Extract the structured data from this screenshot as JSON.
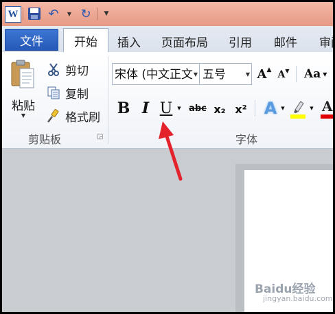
{
  "quick_access": {
    "app_icon": "word-icon",
    "app_letter": "W",
    "save_icon": "save-icon",
    "undo_icon": "undo-icon",
    "redo_icon": "redo-icon",
    "customize_icon": "customize-icon"
  },
  "tabs": {
    "file": "文件",
    "home": "开始",
    "items": [
      "插入",
      "页面布局",
      "引用",
      "邮件",
      "审阅"
    ]
  },
  "clipboard": {
    "paste": "粘贴",
    "cut": "剪切",
    "copy": "复制",
    "format_painter": "格式刷",
    "group_label": "剪贴板"
  },
  "font": {
    "name": "宋体 (中文正文",
    "size": "五号",
    "group_label": "字体",
    "bold": "B",
    "italic": "I",
    "underline": "U",
    "strikethrough": "abc",
    "subscript": "x₂",
    "superscript": "x²",
    "grow": "A",
    "shrink": "A",
    "change_case": "Aa",
    "text_effects": "A",
    "highlight_color": "#ffff00",
    "font_color": "#e00000"
  },
  "annotation": {
    "arrow_color": "#e3222b"
  },
  "watermark": {
    "text": "Baidu经验",
    "sub": "jingyan.baidu.com"
  }
}
